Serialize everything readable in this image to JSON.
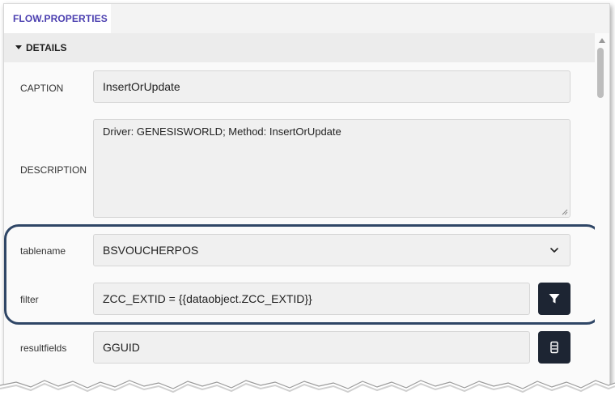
{
  "tab": {
    "label": "FLOW.PROPERTIES"
  },
  "section": {
    "title": "DETAILS"
  },
  "fields": {
    "caption": {
      "label": "CAPTION",
      "value": "InsertOrUpdate"
    },
    "description": {
      "label": "DESCRIPTION",
      "value": "Driver: GENESISWORLD; Method: InsertOrUpdate"
    },
    "tablename": {
      "label": "tablename",
      "value": "BSVOUCHERPOS"
    },
    "filter": {
      "label": "filter",
      "value": "ZCC_EXTID = {{dataobject.ZCC_EXTID}}"
    },
    "resultfields": {
      "label": "resultfields",
      "value": "GGUID"
    }
  },
  "icons": {
    "filter_button": "filter-icon",
    "resultfields_button": "list-icon",
    "dropdown": "chevron-down-icon"
  },
  "colors": {
    "accent": "#4b3fb0",
    "button_bg": "#1d2533",
    "highlight_border": "#2f4666"
  }
}
